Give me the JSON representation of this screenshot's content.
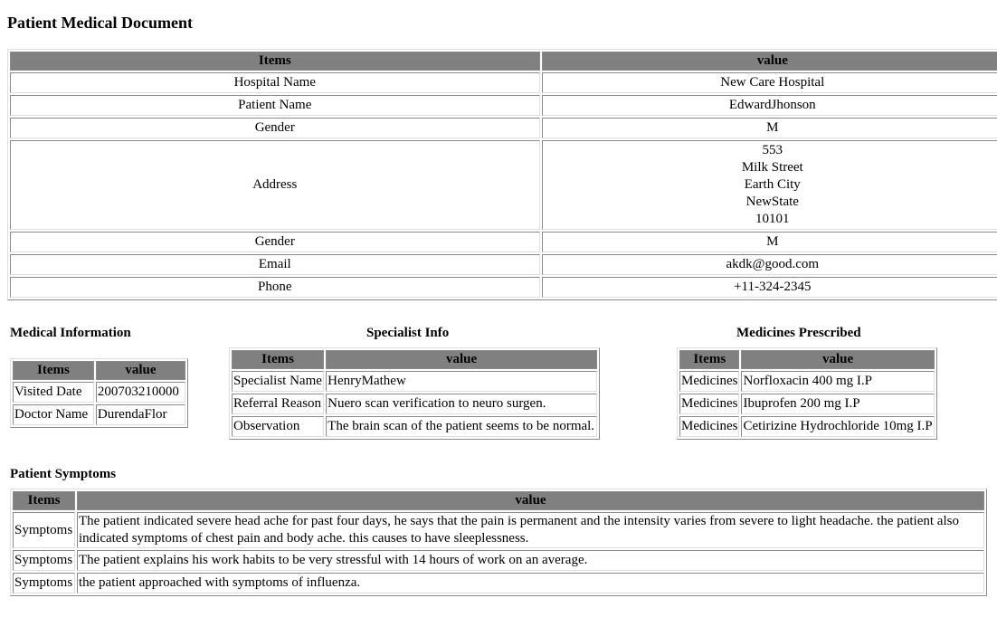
{
  "document": {
    "title": "Patient Medical Document"
  },
  "patient_table": {
    "headers": [
      "Items",
      "value"
    ],
    "rows": [
      {
        "item": "Hospital Name",
        "value": "New Care Hospital"
      },
      {
        "item": "Patient Name",
        "value": "EdwardJhonson"
      },
      {
        "item": "Gender",
        "value": "M"
      },
      {
        "item": "Address",
        "lines": [
          "553",
          "Milk Street",
          "Earth City",
          "NewState",
          "10101"
        ]
      },
      {
        "item": "Gender",
        "value": "M"
      },
      {
        "item": "Email",
        "value": "akdk@good.com"
      },
      {
        "item": "Phone",
        "value": "+11-324-2345"
      }
    ]
  },
  "medical_information": {
    "heading": "Medical Information",
    "headers": [
      "Items",
      "value"
    ],
    "rows": [
      {
        "item": "Visited Date",
        "value": "200703210000"
      },
      {
        "item": "Doctor Name",
        "value": "DurendaFlor"
      }
    ]
  },
  "specialist_info": {
    "heading": "Specialist Info",
    "headers": [
      "Items",
      "value"
    ],
    "rows": [
      {
        "item": "Specialist Name",
        "value": "HenryMathew"
      },
      {
        "item": "Referral Reason",
        "value": "Nuero scan verification to neuro surgen."
      },
      {
        "item": "Observation",
        "value": "The brain scan of the patient seems to be normal."
      }
    ]
  },
  "medicines_prescribed": {
    "heading": "Medicines Prescribed",
    "headers": [
      "Items",
      "value"
    ],
    "rows": [
      {
        "item": "Medicines",
        "value": "Norfloxacin 400 mg I.P"
      },
      {
        "item": "Medicines",
        "value": "Ibuprofen 200 mg I.P"
      },
      {
        "item": "Medicines",
        "value": "Cetirizine Hydrochloride 10mg I.P"
      }
    ]
  },
  "patient_symptoms": {
    "heading": "Patient Symptoms",
    "headers": [
      "Items",
      "value"
    ],
    "rows": [
      {
        "item": "Symptoms",
        "value": "The patient indicated severe head ache for past four days, he says that the pain is permanent and the intensity varies from severe to light headache. the patient also indicated symptoms of chest pain and body ache. this causes to have sleeplessness."
      },
      {
        "item": "Symptoms",
        "value": "The patient explains his work habits to be very stressful with 14 hours of work on an average."
      },
      {
        "item": "Symptoms",
        "value": "the patient approached with symptoms of influenza."
      }
    ]
  }
}
